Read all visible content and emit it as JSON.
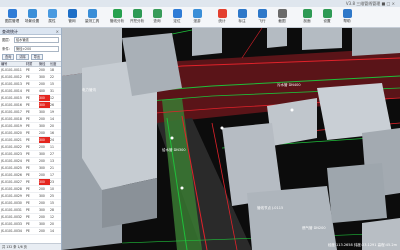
{
  "app": {
    "title": "V3.8 三维管线管理 ■ □ ×"
  },
  "toolbar": [
    {
      "label": "图层管理",
      "color": "#2f7cd6"
    },
    {
      "label": "场景设置",
      "color": "#3b8fd8"
    },
    {
      "label": "属性",
      "color": "#4a9ae0"
    },
    {
      "label": "管网",
      "color": "#1e6fc7"
    },
    {
      "label": "量测工具",
      "color": "#3a8ed7"
    },
    {
      "label": "管线分析",
      "color": "#27a14f"
    },
    {
      "label": "开挖分析",
      "color": "#2e9a55"
    },
    {
      "label": "查询",
      "color": "#389c5a"
    },
    {
      "label": "定位",
      "color": "#2f7cd6"
    },
    {
      "label": "漫游",
      "color": "#3b8fd8"
    },
    {
      "label": "统计",
      "color": "#e3402f"
    },
    {
      "label": "标注",
      "color": "#2e78c9"
    },
    {
      "label": "飞行",
      "color": "#2e78c9"
    },
    {
      "label": "截图",
      "color": "#6a6a6a"
    },
    {
      "label": "剖面",
      "color": "#2e9a55"
    },
    {
      "label": "设置",
      "color": "#2e9a55"
    },
    {
      "label": "帮助",
      "color": "#2e78c9"
    }
  ],
  "panel": {
    "title": "查询统计",
    "close": "×",
    "field1": {
      "label": "图层:",
      "value": "给水管线"
    },
    "field2": {
      "label": "条件:",
      "value": "管径>200"
    },
    "buttons": [
      "查询",
      "清除",
      "导出"
    ],
    "columns": [
      "编号",
      "材质",
      "管径",
      "长度"
    ],
    "rows": [
      {
        "id": "JS-0101-0011",
        "material": "PE",
        "diameter": "200",
        "length": "18",
        "highlight": false
      },
      {
        "id": "JS-0101-0012",
        "material": "PE",
        "diameter": "300",
        "length": "22",
        "highlight": false
      },
      {
        "id": "JS-0101-0013",
        "material": "PE",
        "diameter": "200",
        "length": "15",
        "highlight": false
      },
      {
        "id": "JS-0101-0014",
        "material": "PE",
        "diameter": "400",
        "length": "31",
        "highlight": false
      },
      {
        "id": "JS-0101-0015",
        "material": "PE",
        "diameter": "300",
        "length": "12",
        "highlight": true
      },
      {
        "id": "JS-0101-0016",
        "material": "PE",
        "diameter": "300",
        "length": "26",
        "highlight": true
      },
      {
        "id": "JS-0101-0017",
        "material": "PE",
        "diameter": "300",
        "length": "19",
        "highlight": false
      },
      {
        "id": "JS-0101-0018",
        "material": "PE",
        "diameter": "200",
        "length": "14",
        "highlight": false
      },
      {
        "id": "JS-0101-0019",
        "material": "PE",
        "diameter": "300",
        "length": "20",
        "highlight": false
      },
      {
        "id": "JS-0101-0020",
        "material": "PE",
        "diameter": "200",
        "length": "16",
        "highlight": false
      },
      {
        "id": "JS-0101-0021",
        "material": "PE",
        "diameter": "300",
        "length": "24",
        "highlight": true
      },
      {
        "id": "JS-0101-0022",
        "material": "PE",
        "diameter": "200",
        "length": "11",
        "highlight": false
      },
      {
        "id": "JS-0101-0023",
        "material": "PE",
        "diameter": "300",
        "length": "27",
        "highlight": false
      },
      {
        "id": "JS-0101-0024",
        "material": "PE",
        "diameter": "200",
        "length": "13",
        "highlight": false
      },
      {
        "id": "JS-0101-0025",
        "material": "PE",
        "diameter": "300",
        "length": "21",
        "highlight": false
      },
      {
        "id": "JS-0101-0026",
        "material": "PE",
        "diameter": "200",
        "length": "17",
        "highlight": false
      },
      {
        "id": "JS-0101-0027",
        "material": "PE",
        "diameter": "300",
        "length": "23",
        "highlight": true
      },
      {
        "id": "JS-0101-0028",
        "material": "PE",
        "diameter": "200",
        "length": "10",
        "highlight": false
      },
      {
        "id": "JS-0101-0029",
        "material": "PE",
        "diameter": "300",
        "length": "25",
        "highlight": false
      },
      {
        "id": "JS-0101-0030",
        "material": "PE",
        "diameter": "200",
        "length": "15",
        "highlight": false
      },
      {
        "id": "JS-0101-0031",
        "material": "PE",
        "diameter": "300",
        "length": "28",
        "highlight": false
      },
      {
        "id": "JS-0101-0032",
        "material": "PE",
        "diameter": "200",
        "length": "12",
        "highlight": false
      },
      {
        "id": "JS-0101-0033",
        "material": "PE",
        "diameter": "300",
        "length": "20",
        "highlight": false
      },
      {
        "id": "JS-0101-0034",
        "material": "PE",
        "diameter": "200",
        "length": "14",
        "highlight": false
      }
    ],
    "footer": "共 132 条  1/6 页"
  },
  "viewport": {
    "labels": [
      "给水管 DN300",
      "污水管 DN400",
      "管线节点 J-0115",
      "电力管沟",
      "燃气管 DN200"
    ],
    "status": "经度:113.2658 纬度:23.1291 高程:45.2m",
    "colors": {
      "ground": "#0c0c0c",
      "road": "#5a1418",
      "green_pipe": "#1fbf3a",
      "red_pipe": "#e0222a",
      "building": "#a8b0b8"
    }
  }
}
